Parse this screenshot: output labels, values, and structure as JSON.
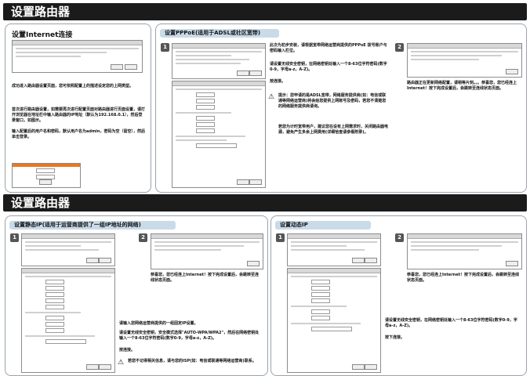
{
  "top_title": "设置路由器",
  "bottom_title": "设置路由器",
  "left": {
    "heading": "设置Internet连接",
    "p1": "成功进入路由器设置页面，您可依照配置上的描述设定您的上网类型。",
    "p2": "首次进行路由器设置，如需要再次进行配置页面对路由器进行页面设置，请打开浏览器在地址栏中输入路由器的IP地址（默认为192.168.0.1），然后登录窗口，如图示。",
    "p3": "输入配置后的用户名和密码，默认用户名为admin，密码为空（留空），然后单击登录。"
  },
  "pppoe": {
    "header": "设置PPPoE(适用于ADSL或社区宽带)",
    "t1": "此次为初步安装，请根据宽带网络运营商提供的PPPoE 拨号账户与密码输入栏位。",
    "t2": "请设置无线安全密钥，在网络密钥处输入一个8-63位字符密码(数字0-9，字母a-z，A-Z)。",
    "t3": "按连接。",
    "note": "提示：您申请的是ADSL宽带，网络服务提供商(如：电信或联通等网络运营商)将会给您提供上网账号及密码，若您不清楚您的网络服务提供商请询。",
    "note2": "若您为计时宽带用户，建议您在设有上网需求时，关闭路由器电源，避免产生多余上网费用(详细恰查请参看附录)。",
    "step2": "路由器正在更新网络配置，请稍等片刻。。。恭喜您，您已经连上Internet！按下完成设置后，会跳转至连线状态页面。"
  },
  "static": {
    "header": "设置静态IP(适用于运营商提供了一组IP地址的网络)",
    "t1": "请输入您网络运营商提供的一组固定IP设置。",
    "t2": "请设置无线安全密钥，安全模式选择\"AUTO-WPA/WPA2\"，然后在网络密钥处输入一个8-63位字符密码(数字0-9，字母a-z，A-Z)。",
    "t3": "按连接。",
    "note": "若您不记得相关信息，请与您的ISP(如：电信或联通等网络运营商)联系。",
    "step2": "恭喜您，您已经连上Internet！按下完成设置后，会跳转至连线状态页面。"
  },
  "dynamic": {
    "header": "设置动态IP",
    "t1": "请设置无线安全密钥，在网络密钥处输入一个8-63位字符密码(数字0-9，字母a-z，A-Z)。",
    "t2": "按下连接。",
    "step2": "恭喜您，您已经连上Internet！按下完成设置后，会跳转至连线状态页面。"
  },
  "steps": {
    "one": "1",
    "two": "2"
  },
  "warn_icon": "⚠"
}
